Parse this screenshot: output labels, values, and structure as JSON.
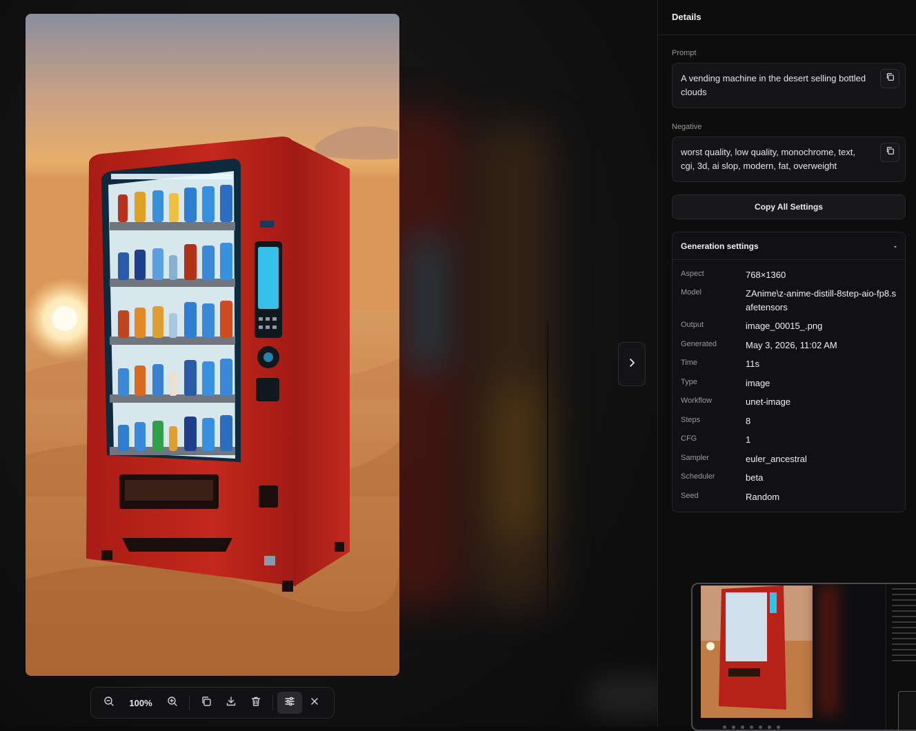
{
  "toolbar": {
    "zoom_label": "100%",
    "buttons": [
      "zoom-out-icon",
      "zoom-in-icon",
      "copy-icon",
      "download-icon",
      "trash-icon",
      "sliders-icon",
      "close-icon"
    ]
  },
  "panel": {
    "title": "Details",
    "prompt": {
      "label": "Prompt",
      "text": "A vending machine in the desert selling bottled clouds"
    },
    "negative": {
      "label": "Negative",
      "text": "worst quality, low quality, monochrome, text, cgi, 3d, ai slop, modern, fat, overweight"
    },
    "copy_all_label": "Copy All Settings",
    "generation": {
      "title": "Generation settings",
      "collapse_symbol": "-",
      "rows": [
        {
          "key": "Aspect",
          "value": "768×1360"
        },
        {
          "key": "Model",
          "value": "ZAnime\\z-anime-distill-8step-aio-fp8.safetensors"
        },
        {
          "key": "Output",
          "value": "image_00015_.png"
        },
        {
          "key": "Generated",
          "value": "May 3, 2026, 11:02 AM"
        },
        {
          "key": "Time",
          "value": "11s"
        },
        {
          "key": "Type",
          "value": "image"
        },
        {
          "key": "Workflow",
          "value": "unet-image"
        },
        {
          "key": "Steps",
          "value": "8"
        },
        {
          "key": "CFG",
          "value": "1"
        },
        {
          "key": "Sampler",
          "value": "euler_ancestral"
        },
        {
          "key": "Scheduler",
          "value": "beta"
        },
        {
          "key": "Seed",
          "value": "Random"
        }
      ]
    }
  },
  "colors": {
    "background": "#0b0b0c",
    "panel": "#0d0d0e",
    "machine_red": "#b8201a",
    "sky_top": "#8a8f9e",
    "sand": "#c98a4e"
  }
}
